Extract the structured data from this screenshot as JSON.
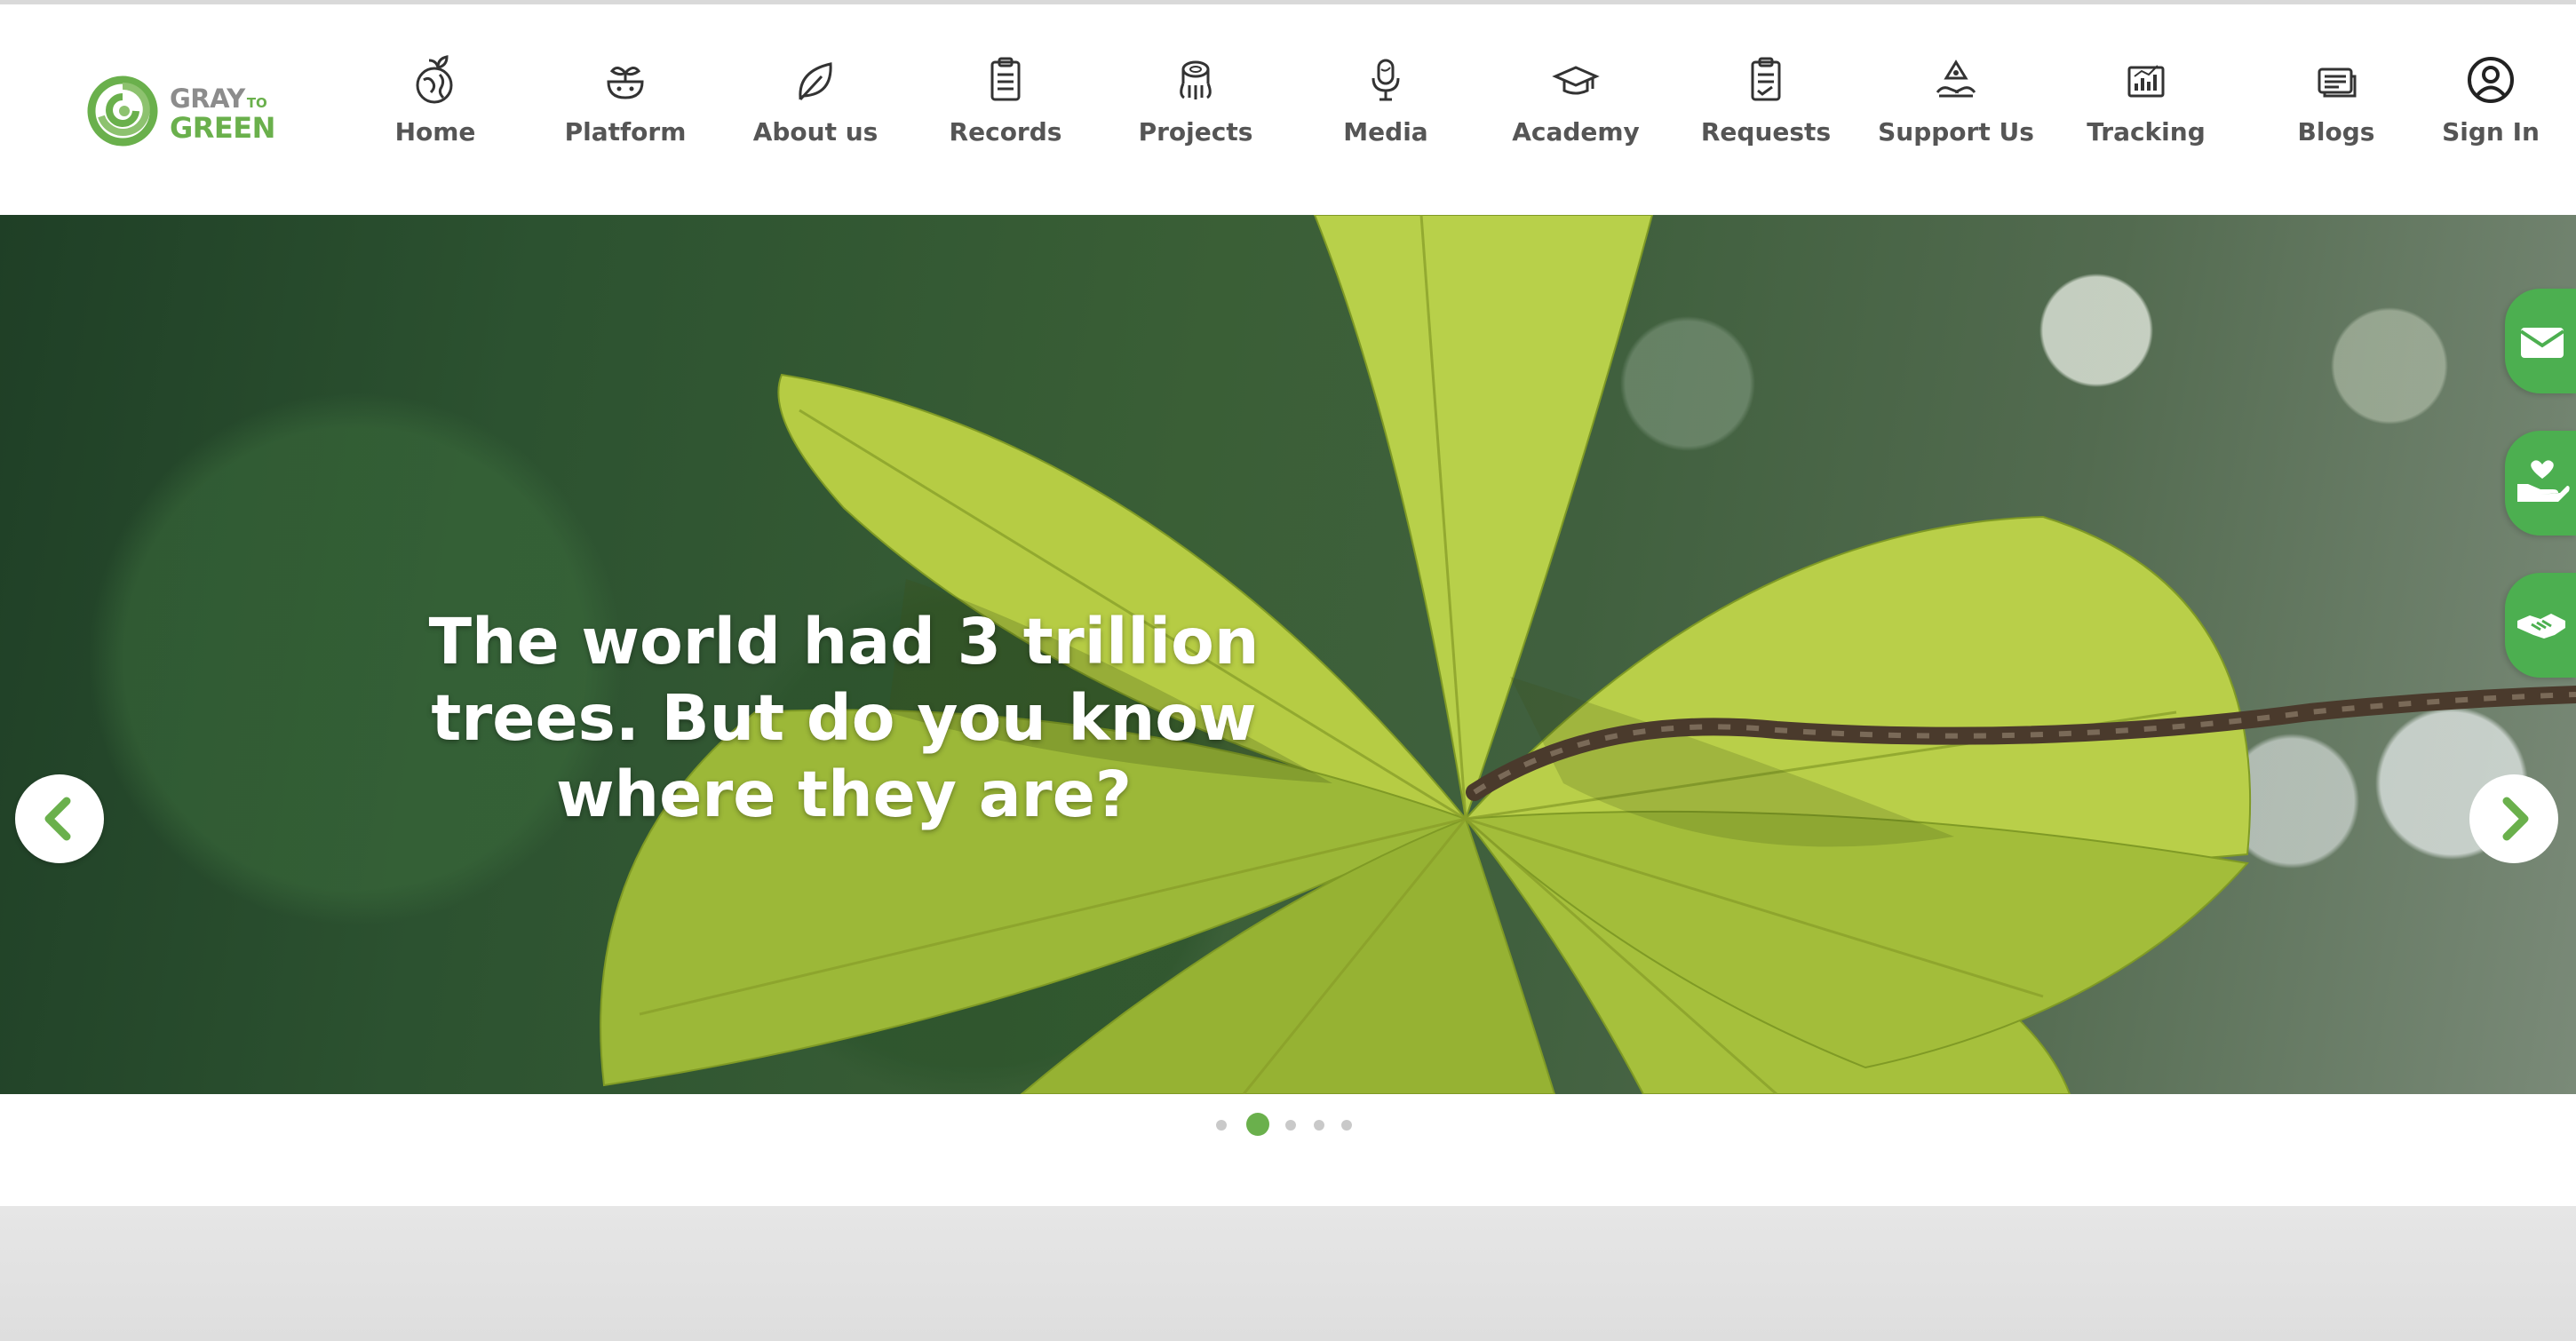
{
  "brand": {
    "name_part1": "GRAY",
    "name_part2": "TO",
    "name_part3": "GREEN",
    "accent_color": "#6ab04c"
  },
  "nav": [
    {
      "label": "Home",
      "icon": "globe-seedling-icon"
    },
    {
      "label": "Platform",
      "icon": "sprout-bowl-icon"
    },
    {
      "label": "About us",
      "icon": "leaf-icon"
    },
    {
      "label": "Records",
      "icon": "clipboard-list-icon"
    },
    {
      "label": "Projects",
      "icon": "tree-stump-icon"
    },
    {
      "label": "Media",
      "icon": "microphone-icon"
    },
    {
      "label": "Academy",
      "icon": "graduation-cap-icon"
    },
    {
      "label": "Requests",
      "icon": "clipboard-check-icon"
    },
    {
      "label": "Support Us",
      "icon": "hands-recycle-icon"
    },
    {
      "label": "Tracking",
      "icon": "bar-chart-icon"
    },
    {
      "label": "Blogs",
      "icon": "blog-card-icon"
    },
    {
      "label": "Sign In",
      "icon": "user-circle-icon"
    }
  ],
  "hero": {
    "headline": "The world had 3 trillion trees. But do you know where they are?",
    "active_slide": 2,
    "slide_count": 5
  },
  "carousel": {
    "prev_icon": "chevron-left-icon",
    "next_icon": "chevron-right-icon"
  },
  "side_actions": [
    {
      "icon": "envelope-icon",
      "color": "#4caf50"
    },
    {
      "icon": "hand-heart-icon",
      "color": "#4caf50"
    },
    {
      "icon": "handshake-icon",
      "color": "#4caf50"
    }
  ]
}
